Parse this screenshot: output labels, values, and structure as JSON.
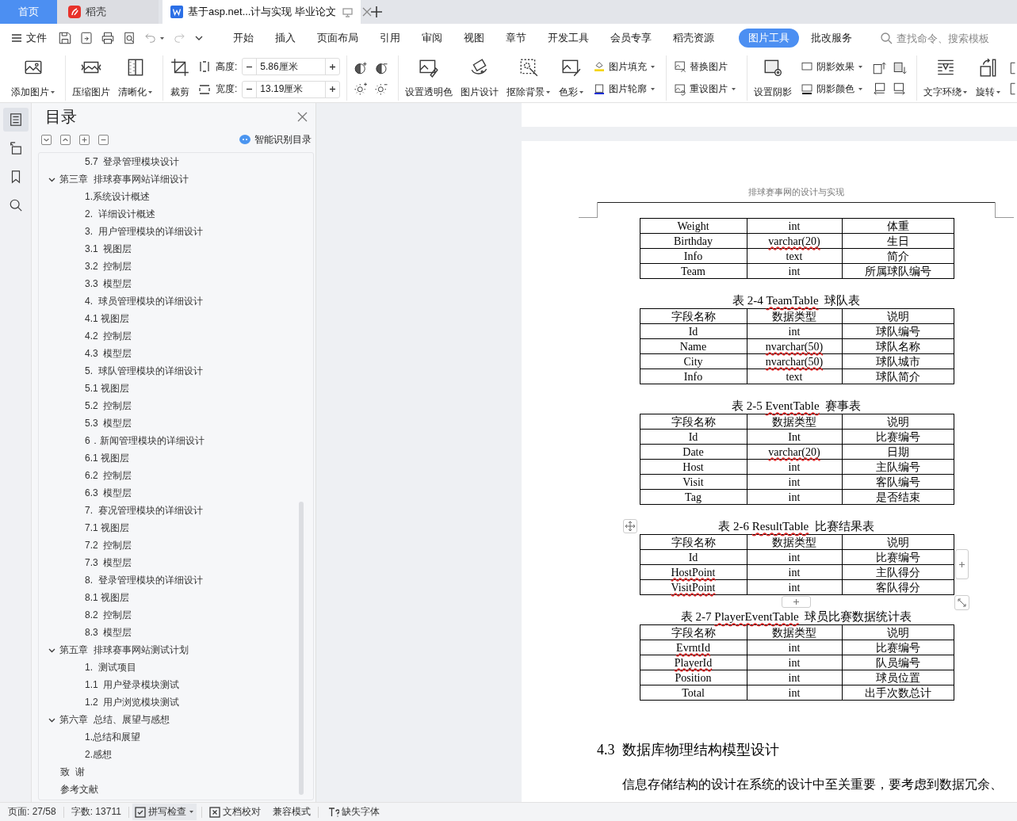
{
  "tabs": [
    {
      "kind": "home",
      "label": "首页",
      "selected": false
    },
    {
      "kind": "app",
      "label": "稻壳",
      "selected": false
    },
    {
      "kind": "document",
      "label": "基于asp.net...计与实现 毕业论文",
      "selected": true
    }
  ],
  "menu": {
    "file_label": "文件",
    "tabs": [
      {
        "label": "开始",
        "selected": false
      },
      {
        "label": "插入",
        "selected": false
      },
      {
        "label": "页面布局",
        "selected": false
      },
      {
        "label": "引用",
        "selected": false
      },
      {
        "label": "审阅",
        "selected": false
      },
      {
        "label": "视图",
        "selected": false
      },
      {
        "label": "章节",
        "selected": false
      },
      {
        "label": "开发工具",
        "selected": false
      },
      {
        "label": "会员专享",
        "selected": false
      },
      {
        "label": "稻壳资源",
        "selected": false
      },
      {
        "label": "图片工具",
        "selected": true
      },
      {
        "label": "批改服务",
        "selected": false
      }
    ],
    "search": {
      "placeholder": "查找命令、搜索模板"
    }
  },
  "ribbon": [
    {
      "items": [
        {
          "kind": "large",
          "label": "添加图片",
          "dropdown": true
        }
      ]
    },
    {
      "items": [
        {
          "kind": "large",
          "label": "压缩图片",
          "dropdown": false
        },
        {
          "kind": "large",
          "label": "清晰化",
          "dropdown": true
        }
      ]
    },
    {
      "items": [
        {
          "kind": "large",
          "label": "裁剪",
          "dropdown": false
        },
        {
          "kind": "size",
          "height_label": "高度:",
          "height_value": "5.86厘米",
          "width_label": "宽度:",
          "width_value": "13.19厘米"
        }
      ]
    },
    {
      "items": [
        {
          "kind": "icon_grid"
        }
      ]
    },
    {
      "items": [
        {
          "kind": "large",
          "label": "设置透明色",
          "dropdown": false
        },
        {
          "kind": "large",
          "label": "图片设计",
          "dropdown": false
        },
        {
          "kind": "large",
          "label": "抠除背景",
          "dropdown": true
        },
        {
          "kind": "large",
          "label": "色彩",
          "dropdown": true
        },
        {
          "kind": "stack",
          "rows": [
            {
              "label": "图片填充",
              "dropdown": true
            },
            {
              "label": "图片轮廓",
              "dropdown": true
            }
          ]
        }
      ]
    },
    {
      "items": [
        {
          "kind": "stack",
          "rows": [
            {
              "label": "替换图片",
              "dropdown": false
            },
            {
              "label": "重设图片",
              "dropdown": true
            }
          ]
        }
      ]
    },
    {
      "items": [
        {
          "kind": "large",
          "label": "设置阴影",
          "dropdown": false
        },
        {
          "kind": "stack",
          "rows": [
            {
              "label": "阴影效果",
              "dropdown": true
            },
            {
              "label": "阴影颜色",
              "dropdown": true
            }
          ]
        },
        {
          "kind": "icon_grid"
        }
      ]
    },
    {
      "items": [
        {
          "kind": "large",
          "label": "文字环绕",
          "dropdown": true
        },
        {
          "kind": "large",
          "label": "旋转",
          "dropdown": true
        },
        {
          "kind": "icon_grid"
        }
      ]
    }
  ],
  "rail": [
    {
      "selected": true
    },
    {
      "selected": false
    },
    {
      "selected": false
    },
    {
      "selected": false
    }
  ],
  "toc": {
    "title": "目录",
    "smart_link": "智能识别目录",
    "continued_items": [
      {
        "text": "5.7  登录管理模块设计"
      }
    ],
    "items": [
      {
        "text": "第三章  排球赛事网站详细设计",
        "expanded": true,
        "children": [
          {
            "text": "1.系统设计概述"
          },
          {
            "text": "2.  详细设计概述"
          },
          {
            "text": "3.  用户管理模块的详细设计"
          },
          {
            "text": "3.1  视图层"
          },
          {
            "text": "3.2  控制层"
          },
          {
            "text": "3.3  模型层"
          },
          {
            "text": "4.  球员管理模块的详细设计"
          },
          {
            "text": "4.1 视图层"
          },
          {
            "text": "4.2  控制层"
          },
          {
            "text": "4.3  模型层"
          },
          {
            "text": "5.  球队管理模块的详细设计"
          },
          {
            "text": "5.1 视图层"
          },
          {
            "text": "5.2  控制层"
          },
          {
            "text": "5.3  模型层"
          },
          {
            "text": "6．新闻管理模块的详细设计"
          },
          {
            "text": "6.1 视图层"
          },
          {
            "text": "6.2  控制层"
          },
          {
            "text": "6.3  模型层"
          },
          {
            "text": "7.  赛况管理模块的详细设计"
          },
          {
            "text": "7.1 视图层"
          },
          {
            "text": "7.2  控制层"
          },
          {
            "text": "7.3  模型层"
          },
          {
            "text": "8.  登录管理模块的详细设计"
          },
          {
            "text": "8.1 视图层"
          },
          {
            "text": "8.2  控制层"
          },
          {
            "text": "8.3  模型层"
          }
        ]
      },
      {
        "text": "第五章  排球赛事网站测试计划",
        "expanded": true,
        "children": [
          {
            "text": "1.  测试项目"
          },
          {
            "text": "1.1  用户登录模块测试"
          },
          {
            "text": "1.2  用户浏览模块测试"
          }
        ]
      },
      {
        "text": "第六章  总结、展望与感想",
        "expanded": true,
        "children": [
          {
            "text": "1.总结和展望"
          },
          {
            "text": "2.感想"
          }
        ]
      },
      {
        "text": "致  谢"
      },
      {
        "text": "参考文献"
      }
    ]
  },
  "document": {
    "header": "排球赛事网的设计与实现",
    "blocks": [
      {
        "kind": "table",
        "selected": false,
        "rows": [
          {
            "cells": [
              "Weight",
              "int",
              "体重"
            ],
            "field_flagged": false,
            "type_flagged": false
          },
          {
            "cells": [
              "Birthday",
              "varchar(20)",
              "生日"
            ],
            "field_flagged": false,
            "type_flagged": true
          },
          {
            "cells": [
              "Info",
              "text",
              "简介"
            ],
            "field_flagged": false,
            "type_flagged": false
          },
          {
            "cells": [
              "Team",
              "int",
              "所属球队编号"
            ],
            "field_flagged": false,
            "type_flagged": false
          }
        ]
      },
      {
        "kind": "table",
        "selected": false,
        "caption": {
          "prefix": "表 2-4",
          "name": "TeamTable",
          "title": "球队表",
          "name_flagged": true
        },
        "columns": [
          "字段名称",
          "数据类型",
          "说明"
        ],
        "rows": [
          {
            "cells": [
              "Id",
              "int",
              "球队编号"
            ],
            "field_flagged": false,
            "type_flagged": false
          },
          {
            "cells": [
              "Name",
              "nvarchar(50)",
              "球队名称"
            ],
            "field_flagged": false,
            "type_flagged": true
          },
          {
            "cells": [
              "City",
              "nvarchar(50)",
              "球队城市"
            ],
            "field_flagged": false,
            "type_flagged": true
          },
          {
            "cells": [
              "Info",
              "text",
              "球队简介"
            ],
            "field_flagged": false,
            "type_flagged": false
          }
        ]
      },
      {
        "kind": "table",
        "selected": false,
        "caption": {
          "prefix": "表 2-5",
          "name": "EventTable",
          "title": "赛事表",
          "name_flagged": true
        },
        "columns": [
          "字段名称",
          "数据类型",
          "说明"
        ],
        "rows": [
          {
            "cells": [
              "Id",
              "Int",
              "比赛编号"
            ],
            "field_flagged": false,
            "type_flagged": false
          },
          {
            "cells": [
              "Date",
              "varchar(20)",
              "日期"
            ],
            "field_flagged": false,
            "type_flagged": true
          },
          {
            "cells": [
              "Host",
              "int",
              "主队编号"
            ],
            "field_flagged": false,
            "type_flagged": false
          },
          {
            "cells": [
              "Visit",
              "int",
              "客队编号"
            ],
            "field_flagged": false,
            "type_flagged": false
          },
          {
            "cells": [
              "Tag",
              "int",
              "是否结束"
            ],
            "field_flagged": false,
            "type_flagged": false
          }
        ]
      },
      {
        "kind": "table",
        "selected": true,
        "caption": {
          "prefix": "表 2-6",
          "name": "ResultTable",
          "title": "比赛结果表",
          "name_flagged": true
        },
        "columns": [
          "字段名称",
          "数据类型",
          "说明"
        ],
        "rows": [
          {
            "cells": [
              "Id",
              "int",
              "比赛编号"
            ],
            "field_flagged": false,
            "type_flagged": false
          },
          {
            "cells": [
              "HostPoint",
              "int",
              "主队得分"
            ],
            "field_flagged": true,
            "type_flagged": false
          },
          {
            "cells": [
              "VisitPoint",
              "int",
              "客队得分"
            ],
            "field_flagged": true,
            "type_flagged": false
          }
        ]
      },
      {
        "kind": "table",
        "selected": false,
        "caption": {
          "prefix": "表 2-7",
          "name": "PlayerEventTable",
          "title": "球员比赛数据统计表",
          "name_flagged": true
        },
        "columns": [
          "字段名称",
          "数据类型",
          "说明"
        ],
        "rows": [
          {
            "cells": [
              "EvrntId",
              "int",
              "比赛编号"
            ],
            "field_flagged": true,
            "type_flagged": false
          },
          {
            "cells": [
              "PlayerId",
              "int",
              "队员编号"
            ],
            "field_flagged": true,
            "type_flagged": false
          },
          {
            "cells": [
              "Position",
              "int",
              "球员位置"
            ],
            "field_flagged": false,
            "type_flagged": false
          },
          {
            "cells": [
              "Total",
              "int",
              "出手次数总计"
            ],
            "field_flagged": false,
            "type_flagged": false
          }
        ]
      },
      {
        "kind": "heading",
        "number": "4.3",
        "text": "数据库物理结构模型设计"
      },
      {
        "kind": "paragraph",
        "text": "信息存储结构的设计在系统的设计中至关重要，要考虑到数据冗余、"
      }
    ]
  },
  "status": {
    "page": "页面: 27/58",
    "words": "字数: 13711",
    "spell_check": "拼写检查",
    "proofread": "文档校对",
    "compat_mode": "兼容模式",
    "missing_fonts": "缺失字体"
  }
}
